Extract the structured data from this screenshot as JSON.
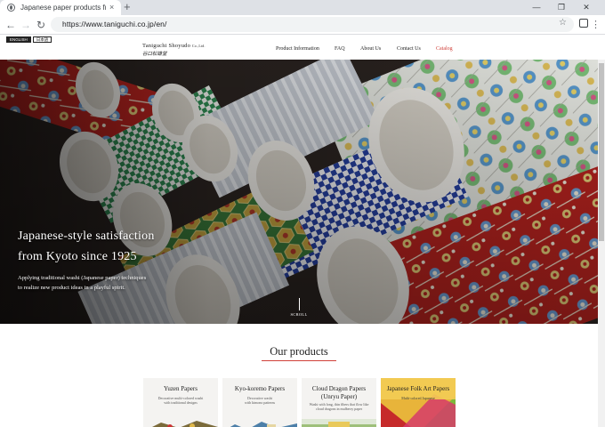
{
  "browser": {
    "tab_title": "Japanese paper products from",
    "tab_close": "×",
    "new_tab": "+",
    "url": "https://www.taniguchi.co.jp/en/",
    "icons": [
      "globe-icon",
      "back-icon",
      "forward-icon",
      "reload-icon",
      "star-icon",
      "extension-icon",
      "menu-icon"
    ],
    "win_min": "—",
    "win_max": "❐",
    "win_close": "✕"
  },
  "header": {
    "lang_en": "ENGLISH",
    "lang_jp": "日本語",
    "logo_name": "Taniguchi Shoyudo",
    "logo_suffix": "Co.,Ltd.",
    "logo_kanji": "谷口松雄堂",
    "nav": [
      {
        "label": "Product Information"
      },
      {
        "label": "FAQ"
      },
      {
        "label": "About Us"
      },
      {
        "label": "Contact Us"
      },
      {
        "label": "Catalog",
        "active": true
      }
    ]
  },
  "hero": {
    "title_line1": "Japanese-style satisfaction",
    "title_line2": "from Kyoto since 1925",
    "subtitle_line1": "Applying traditional washi (Japanese paper) techniques",
    "subtitle_line2": "to realize new product ideas in a playful spirit.",
    "scroll_label": "SCROLL"
  },
  "products": {
    "title": "Our products",
    "cards": [
      {
        "title": "Yuzen Papers",
        "desc1": "Decorative multi-colored washi",
        "desc2": "with traditional designs"
      },
      {
        "title": "Kyo-koremo Papers",
        "desc1": "Decorative washi",
        "desc2": "with kimono patterns"
      },
      {
        "title": "Cloud Dragon Papers",
        "title2": "(Unryu Paper)",
        "desc1": "Washi with long, thin fibers that flow like",
        "desc2": "cloud dragons in mulberry paper"
      },
      {
        "title": "Japanese Folk Art Papers",
        "desc1": "Multi-colored Japanese"
      }
    ]
  },
  "colors": {
    "accent": "#d0413a",
    "chrome_bg": "#dee1e6",
    "omnibox_bg": "#f1f3f4",
    "card_bg": "#f4f3f1"
  }
}
